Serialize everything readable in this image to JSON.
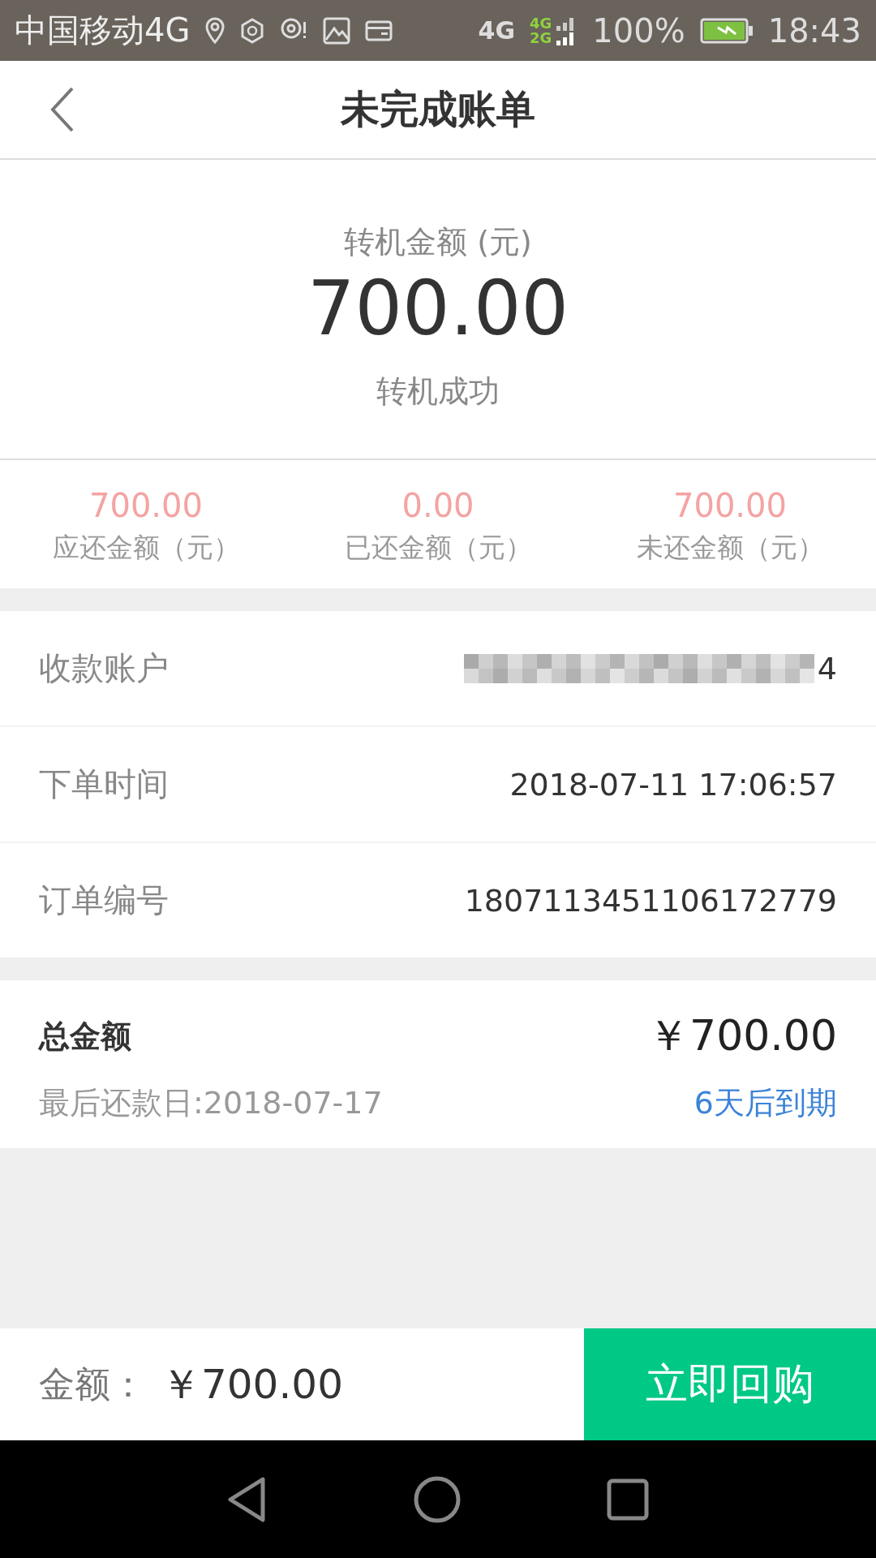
{
  "status_bar": {
    "carrier": "中国移动4G",
    "network": "4G",
    "network_dual": [
      "4G",
      "2G"
    ],
    "battery": "100%",
    "time": "18:43"
  },
  "nav": {
    "title": "未完成账单"
  },
  "header": {
    "label": "转机金额 (元)",
    "amount": "700.00",
    "status": "转机成功"
  },
  "stats": [
    {
      "value": "700.00",
      "label": "应还金额（元）"
    },
    {
      "value": "0.00",
      "label": "已还金额（元）"
    },
    {
      "value": "700.00",
      "label": "未还金额（元）"
    }
  ],
  "details": [
    {
      "label": "收款账户",
      "value": "4",
      "redacted": true
    },
    {
      "label": "下单时间",
      "value": "2018-07-11 17:06:57",
      "redacted": false
    },
    {
      "label": "订单编号",
      "value": "1807113451106172779",
      "redacted": false
    }
  ],
  "total": {
    "label": "总金额",
    "amount": "￥700.00",
    "due_date": "最后还款日:2018-07-17",
    "due_in": "6天后到期"
  },
  "footer": {
    "label": "金额：",
    "amount": "￥700.00",
    "button": "立即回购"
  }
}
